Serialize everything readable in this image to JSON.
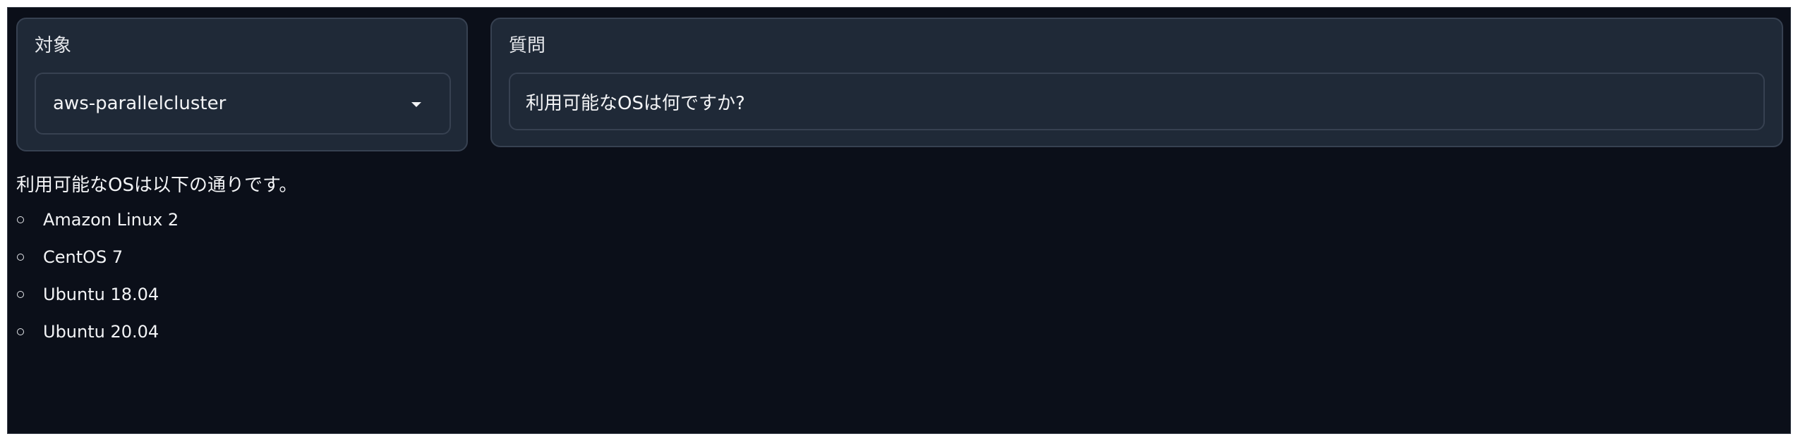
{
  "target_panel": {
    "label": "対象",
    "selected_value": "aws-parallelcluster"
  },
  "question_panel": {
    "label": "質問",
    "input_value": "利用可能なOSは何ですか?"
  },
  "answer": {
    "intro": "利用可能なOSは以下の通りです。",
    "items": [
      "Amazon Linux 2",
      "CentOS 7",
      "Ubuntu 18.04",
      "Ubuntu 20.04"
    ]
  },
  "colors": {
    "background": "#0b0f19",
    "panel": "#1f2937",
    "border": "#374151",
    "text": "#f3f4f6"
  },
  "icons": {
    "dropdown": "caret-down-icon",
    "bullet": "hollow-circle-bullet"
  }
}
